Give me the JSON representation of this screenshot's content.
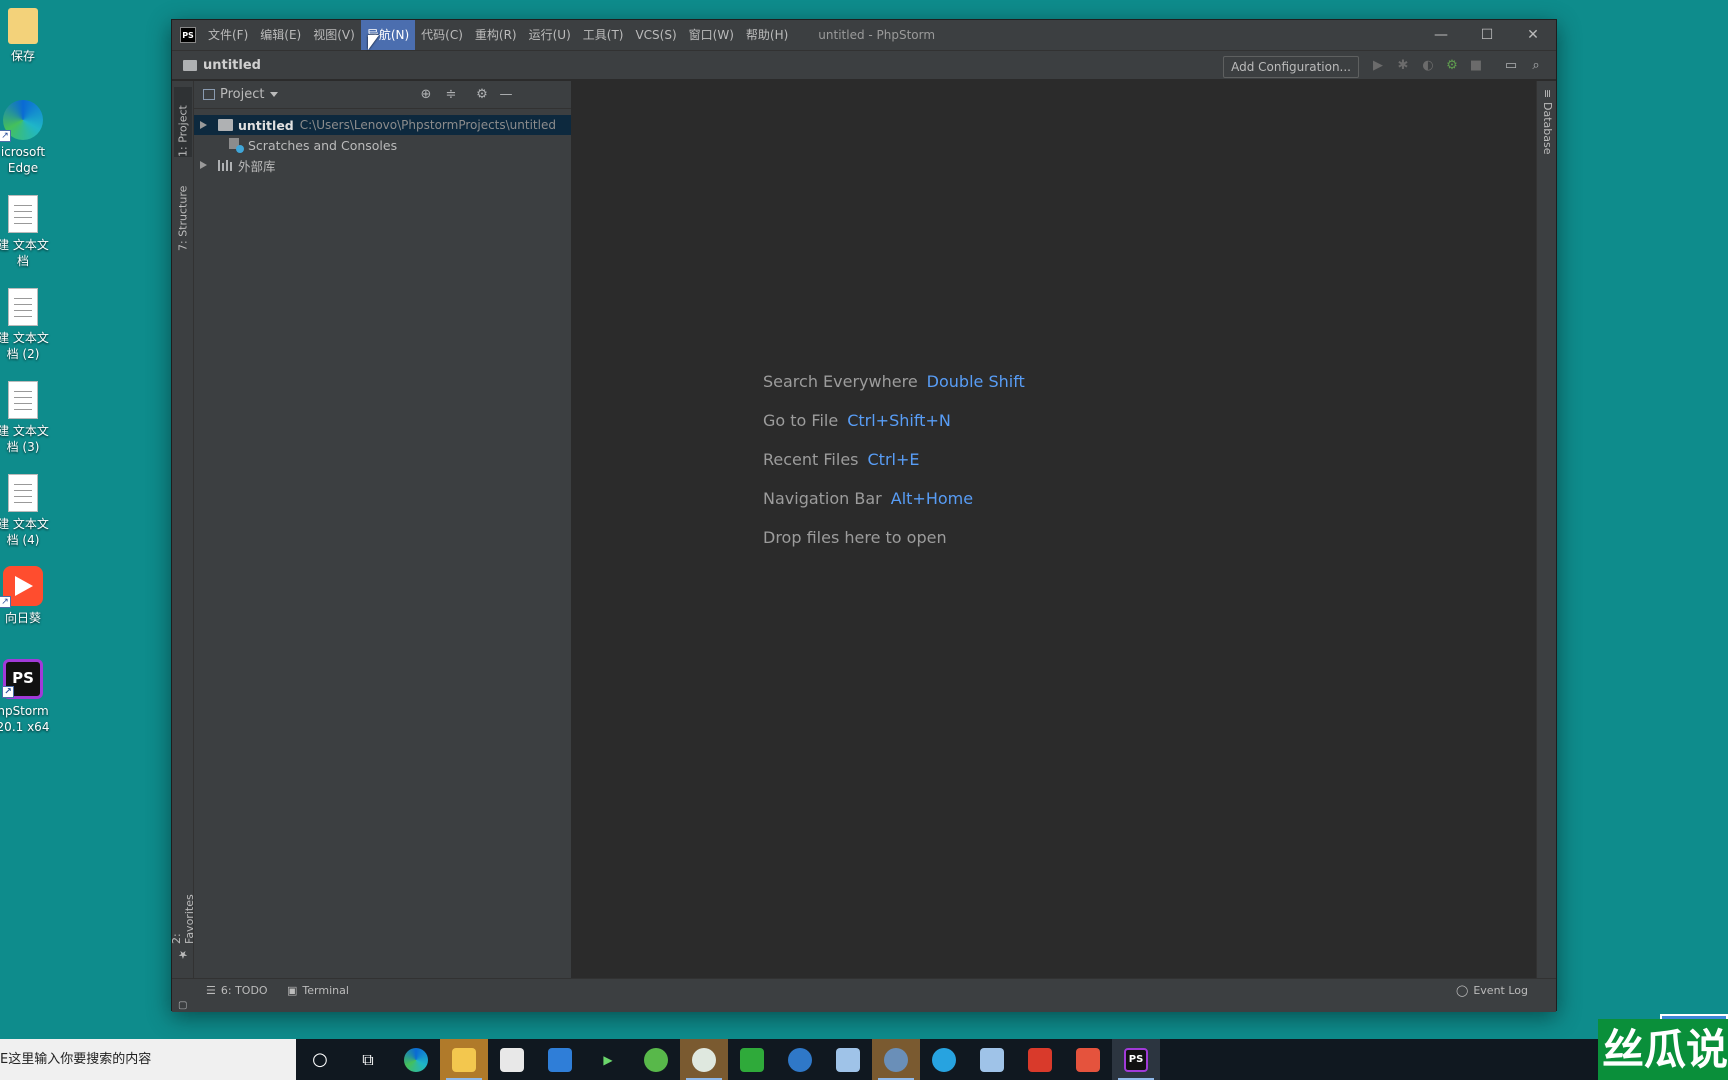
{
  "desktop": {
    "icons": [
      {
        "label": "保存",
        "icon": "folder-icon"
      },
      {
        "label": "icrosoft Edge",
        "icon": "edge-icon"
      },
      {
        "label": "建 文本文档",
        "icon": "text-document-icon"
      },
      {
        "label": "建 文本文档 (2)",
        "icon": "text-document-icon"
      },
      {
        "label": "建 文本文档 (3)",
        "icon": "text-document-icon"
      },
      {
        "label": "建 文本文档 (4)",
        "icon": "text-document-icon"
      },
      {
        "label": "向日葵",
        "icon": "sunflower-icon"
      },
      {
        "label": "npStorm 20.1 x64",
        "icon": "phpstorm-icon"
      }
    ]
  },
  "window": {
    "title": "untitled - PhpStorm",
    "menu": [
      "文件(F)",
      "编辑(E)",
      "视图(V)",
      "导航(N)",
      "代码(C)",
      "重构(R)",
      "运行(U)",
      "工具(T)",
      "VCS(S)",
      "窗口(W)",
      "帮助(H)"
    ],
    "active_menu": "导航(N)",
    "controls": {
      "minimize": "—",
      "maximize": "☐",
      "close": "✕"
    }
  },
  "navbar": {
    "crumb": "untitled",
    "add_configuration": "Add Configuration..."
  },
  "left_stripe": {
    "project_tab": "1: Project",
    "structure_tab": "7: Structure",
    "favorites_tab": "2: Favorites"
  },
  "right_stripe": {
    "database_tab": "Database"
  },
  "project_panel": {
    "title": "Project",
    "tree": [
      {
        "name": "untitled",
        "path": "C:\\Users\\Lenovo\\PhpstormProjects\\untitled"
      },
      {
        "name": "Scratches and Consoles"
      },
      {
        "name": "外部库"
      }
    ]
  },
  "editor": {
    "hints": [
      {
        "text": "Search Everywhere",
        "key": "Double Shift"
      },
      {
        "text": "Go to File",
        "key": "Ctrl+Shift+N"
      },
      {
        "text": "Recent Files",
        "key": "Ctrl+E"
      },
      {
        "text": "Navigation Bar",
        "key": "Alt+Home"
      },
      {
        "text": "Drop files here to open",
        "key": ""
      }
    ]
  },
  "bottom_bar": {
    "todo": "6: TODO",
    "terminal": "Terminal",
    "event_log": "Event Log"
  },
  "taskbar": {
    "search_placeholder": "E这里输入你要搜索的内容",
    "watermark": "丝瓜说"
  },
  "colors": {
    "accent": "#4b6eaf",
    "link": "#589df6",
    "desktop": "#0e8c8c"
  }
}
